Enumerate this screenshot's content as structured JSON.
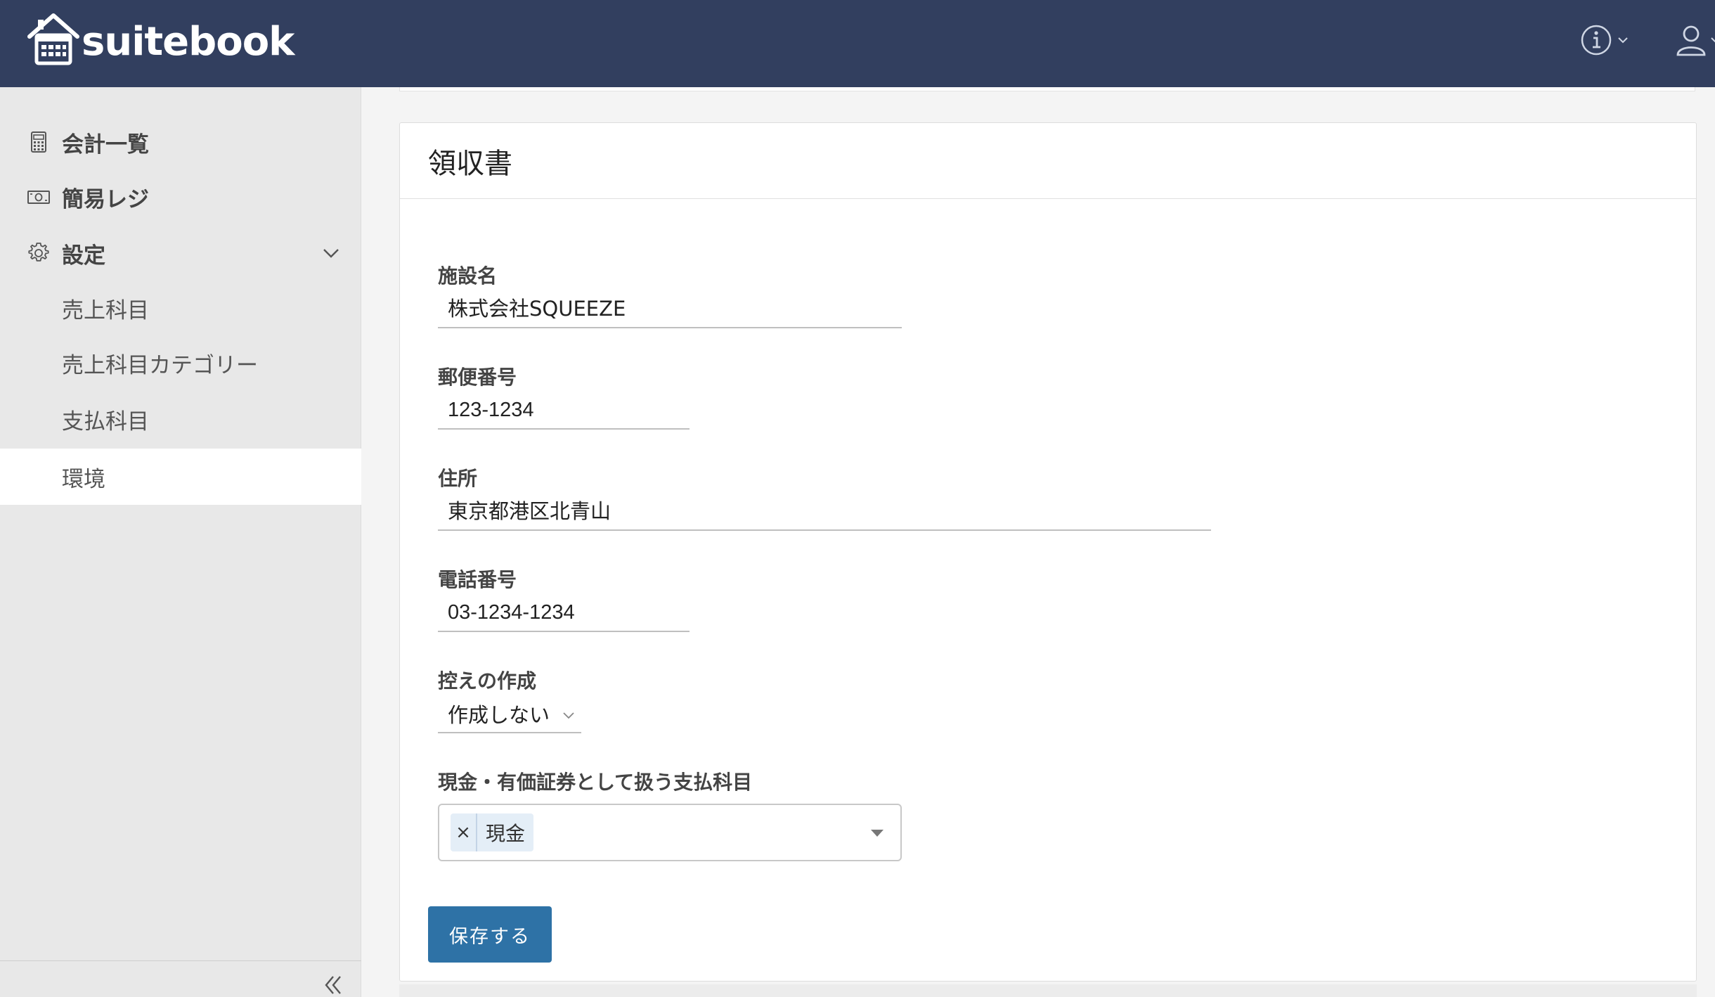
{
  "header": {
    "brand": "suitebook",
    "icons": {
      "info": "info-icon",
      "user": "user-icon"
    },
    "colors": {
      "bg": "#323f5f"
    }
  },
  "sidebar": {
    "items": [
      {
        "label": "会計一覧",
        "icon": "calculator-icon"
      },
      {
        "label": "簡易レジ",
        "icon": "cash-icon"
      },
      {
        "label": "設定",
        "icon": "gear-icon",
        "expanded": true
      }
    ],
    "sub_items": [
      {
        "label": "売上科目"
      },
      {
        "label": "売上科目カテゴリー"
      },
      {
        "label": "支払科目"
      },
      {
        "label": "環境",
        "active": true
      }
    ]
  },
  "card": {
    "title": "領収書",
    "fields": {
      "facility_name": {
        "label": "施設名",
        "value": "株式会社SQUEEZE"
      },
      "postal_code": {
        "label": "郵便番号",
        "value": "123-1234"
      },
      "address": {
        "label": "住所",
        "value": "東京都港区北青山"
      },
      "phone": {
        "label": "電話番号",
        "value": "03-1234-1234"
      },
      "copy": {
        "label": "控えの作成",
        "value": "作成しない"
      },
      "cash_accounts": {
        "label": "現金・有価証券として扱う支払科目",
        "tags": [
          "現金"
        ],
        "remove_glyph": "×"
      }
    },
    "save_label": "保存する"
  },
  "colors": {
    "accent": "#2e72a6",
    "tag_bg": "#e4eef7"
  }
}
